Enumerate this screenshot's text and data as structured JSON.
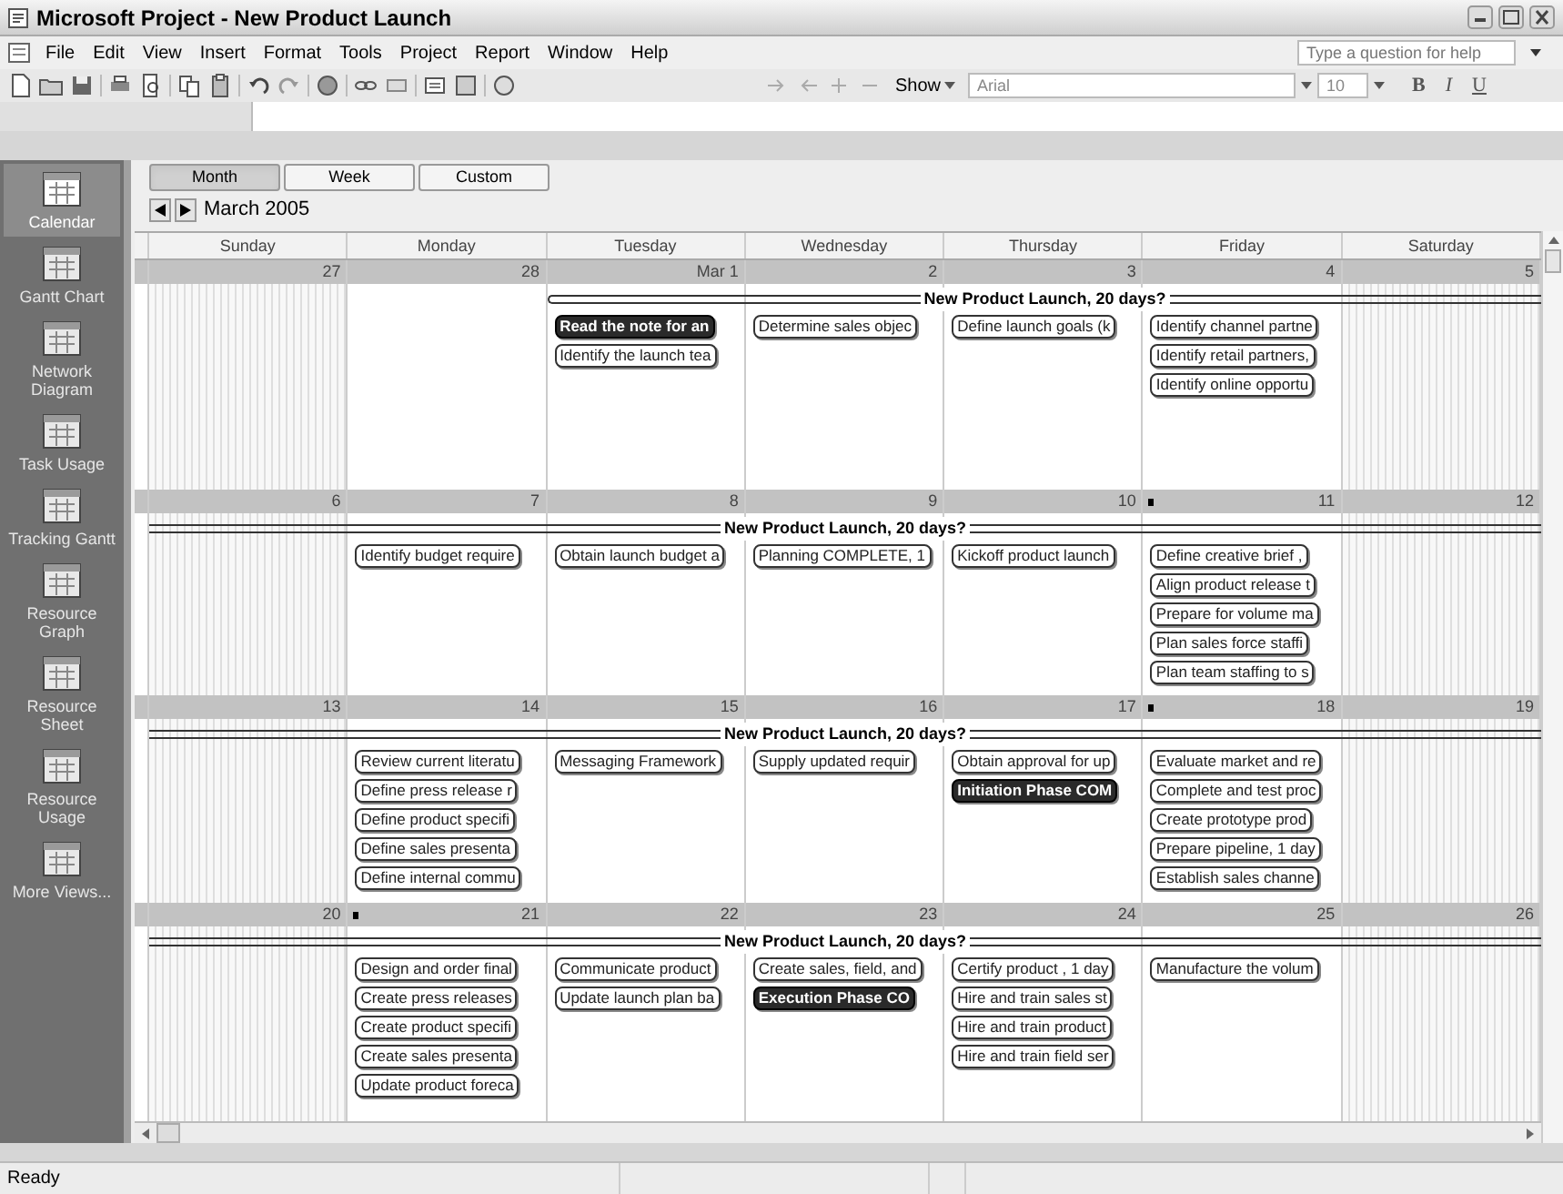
{
  "window": {
    "title": "Microsoft Project - New Product Launch"
  },
  "menu": [
    "File",
    "Edit",
    "View",
    "Insert",
    "Format",
    "Tools",
    "Project",
    "Report",
    "Window",
    "Help"
  ],
  "help_search": {
    "placeholder": "Type a question for help"
  },
  "toolbar": {
    "show": "Show",
    "font": "Arial",
    "size": "10",
    "bold": "B",
    "italic": "I",
    "underline": "U"
  },
  "sidebar": [
    {
      "label": "Calendar",
      "selected": true
    },
    {
      "label": "Gantt Chart",
      "selected": false
    },
    {
      "label": "Network Diagram",
      "selected": false
    },
    {
      "label": "Task Usage",
      "selected": false
    },
    {
      "label": "Tracking Gantt",
      "selected": false
    },
    {
      "label": "Resource Graph",
      "selected": false
    },
    {
      "label": "Resource Sheet",
      "selected": false
    },
    {
      "label": "Resource Usage",
      "selected": false
    },
    {
      "label": "More Views...",
      "selected": false
    }
  ],
  "view_tabs": [
    {
      "label": "Month",
      "selected": true
    },
    {
      "label": "Week",
      "selected": false
    },
    {
      "label": "Custom",
      "selected": false
    }
  ],
  "month": "March 2005",
  "weekdays": [
    "Sunday",
    "Monday",
    "Tuesday",
    "Wednesday",
    "Thursday",
    "Friday",
    "Saturday"
  ],
  "weeks": [
    {
      "summary": {
        "label": "New Product Launch, 20 days?"
      },
      "days": [
        {
          "date": "27",
          "weekend": true
        },
        {
          "date": "28",
          "weekend": false
        },
        {
          "date": "Mar 1",
          "weekend": false,
          "summary_begins": true,
          "tasks": [
            {
              "label": "Read the note for an",
              "kind": "milestone"
            },
            {
              "label": "Identify the launch tea",
              "kind": "task"
            }
          ]
        },
        {
          "date": "2",
          "weekend": false,
          "tasks": [
            {
              "label": "Determine sales objec",
              "kind": "task"
            }
          ]
        },
        {
          "date": "3",
          "weekend": false,
          "tasks": [
            {
              "label": "Define launch goals (k",
              "kind": "task"
            }
          ]
        },
        {
          "date": "4",
          "weekend": false,
          "tasks": [
            {
              "label": "Identify channel partne",
              "kind": "task"
            },
            {
              "label": "Identify retail partners,",
              "kind": "task"
            },
            {
              "label": "Identify online opportu",
              "kind": "task"
            }
          ]
        },
        {
          "date": "5",
          "weekend": true
        }
      ]
    },
    {
      "summary": {
        "label": "New Product Launch, 20 days?"
      },
      "days": [
        {
          "date": "6",
          "weekend": true
        },
        {
          "date": "7",
          "weekend": false,
          "tasks": [
            {
              "label": "Identify budget require",
              "kind": "task"
            }
          ]
        },
        {
          "date": "8",
          "weekend": false,
          "tasks": [
            {
              "label": "Obtain launch budget a",
              "kind": "task"
            }
          ]
        },
        {
          "date": "9",
          "weekend": false,
          "tasks": [
            {
              "label": "Planning COMPLETE, 1",
              "kind": "task"
            }
          ]
        },
        {
          "date": "10",
          "weekend": false,
          "tasks": [
            {
              "label": "Kickoff product launch",
              "kind": "task"
            }
          ]
        },
        {
          "date": "11",
          "weekend": false,
          "marked": true,
          "tasks": [
            {
              "label": "Define creative brief ,",
              "kind": "task"
            },
            {
              "label": "Align product release t",
              "kind": "task"
            },
            {
              "label": "Prepare for volume ma",
              "kind": "task"
            },
            {
              "label": "Plan sales force staffi",
              "kind": "task"
            },
            {
              "label": "Plan team staffing to s",
              "kind": "task"
            }
          ]
        },
        {
          "date": "12",
          "weekend": true
        }
      ]
    },
    {
      "summary": {
        "label": "New Product Launch, 20 days?"
      },
      "days": [
        {
          "date": "13",
          "weekend": true
        },
        {
          "date": "14",
          "weekend": false,
          "tasks": [
            {
              "label": "Review current literatu",
              "kind": "task"
            },
            {
              "label": "Define press release r",
              "kind": "task"
            },
            {
              "label": "Define product specifi",
              "kind": "task"
            },
            {
              "label": "Define sales presenta",
              "kind": "task"
            },
            {
              "label": "Define internal commu",
              "kind": "task"
            }
          ]
        },
        {
          "date": "15",
          "weekend": false,
          "tasks": [
            {
              "label": "Messaging Framework",
              "kind": "task"
            }
          ]
        },
        {
          "date": "16",
          "weekend": false,
          "tasks": [
            {
              "label": "Supply updated requir",
              "kind": "task"
            }
          ]
        },
        {
          "date": "17",
          "weekend": false,
          "tasks": [
            {
              "label": "Obtain approval for up",
              "kind": "task"
            },
            {
              "label": "Initiation Phase COM",
              "kind": "milestone"
            }
          ]
        },
        {
          "date": "18",
          "weekend": false,
          "marked": true,
          "tasks": [
            {
              "label": "Evaluate market and re",
              "kind": "task"
            },
            {
              "label": "Complete and test proc",
              "kind": "task"
            },
            {
              "label": "Create prototype prod",
              "kind": "task"
            },
            {
              "label": "Prepare pipeline, 1 day",
              "kind": "task"
            },
            {
              "label": "Establish sales channe",
              "kind": "task"
            }
          ]
        },
        {
          "date": "19",
          "weekend": true
        }
      ]
    },
    {
      "summary": {
        "label": "New Product Launch, 20 days?"
      },
      "days": [
        {
          "date": "20",
          "weekend": true
        },
        {
          "date": "21",
          "weekend": false,
          "marked": true,
          "tasks": [
            {
              "label": "Design and order final",
              "kind": "task"
            },
            {
              "label": "Create press releases",
              "kind": "task"
            },
            {
              "label": "Create product specifi",
              "kind": "task"
            },
            {
              "label": "Create sales presenta",
              "kind": "task"
            },
            {
              "label": "Update product foreca",
              "kind": "task"
            }
          ]
        },
        {
          "date": "22",
          "weekend": false,
          "tasks": [
            {
              "label": "Communicate product",
              "kind": "task"
            },
            {
              "label": "Update launch plan ba",
              "kind": "task"
            }
          ]
        },
        {
          "date": "23",
          "weekend": false,
          "tasks": [
            {
              "label": "Create sales, field, and",
              "kind": "task"
            },
            {
              "label": "Execution Phase CO",
              "kind": "milestone"
            }
          ]
        },
        {
          "date": "24",
          "weekend": false,
          "tasks": [
            {
              "label": "Certify product , 1 day",
              "kind": "task"
            },
            {
              "label": "Hire and train sales st",
              "kind": "task"
            },
            {
              "label": "Hire and train product",
              "kind": "task"
            },
            {
              "label": "Hire and train field ser",
              "kind": "task"
            }
          ]
        },
        {
          "date": "25",
          "weekend": false,
          "tasks": [
            {
              "label": "Manufacture the volum",
              "kind": "task"
            }
          ]
        },
        {
          "date": "26",
          "weekend": true
        }
      ]
    }
  ],
  "status_bar": "Ready"
}
